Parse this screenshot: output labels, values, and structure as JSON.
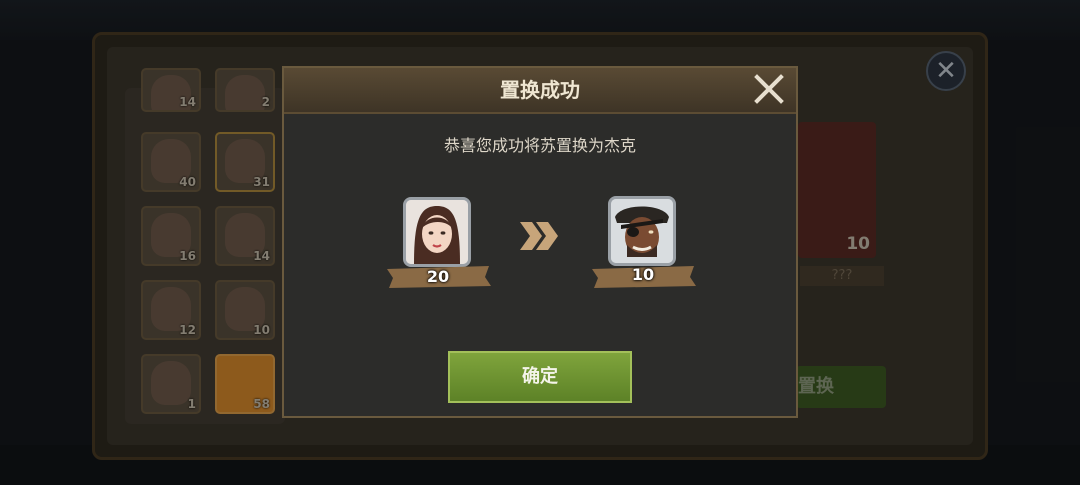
{
  "background": {
    "title": "",
    "hero_counts": [
      "14",
      "2",
      "40",
      "31",
      "16",
      "14",
      "12",
      "10",
      "1",
      "58"
    ],
    "reward_count": "10",
    "reward_unknown": "???",
    "replace_button": "置换"
  },
  "dialog": {
    "title": "置换成功",
    "message": "恭喜您成功将苏置换为杰克",
    "from_hero": {
      "name": "苏",
      "count": "20"
    },
    "to_hero": {
      "name": "杰克",
      "count": "10"
    },
    "confirm_label": "确定"
  },
  "colors": {
    "confirm_green": "#6e9330",
    "dialog_bg": "#2c2c2a",
    "title_bar": "#4d3f2d"
  }
}
